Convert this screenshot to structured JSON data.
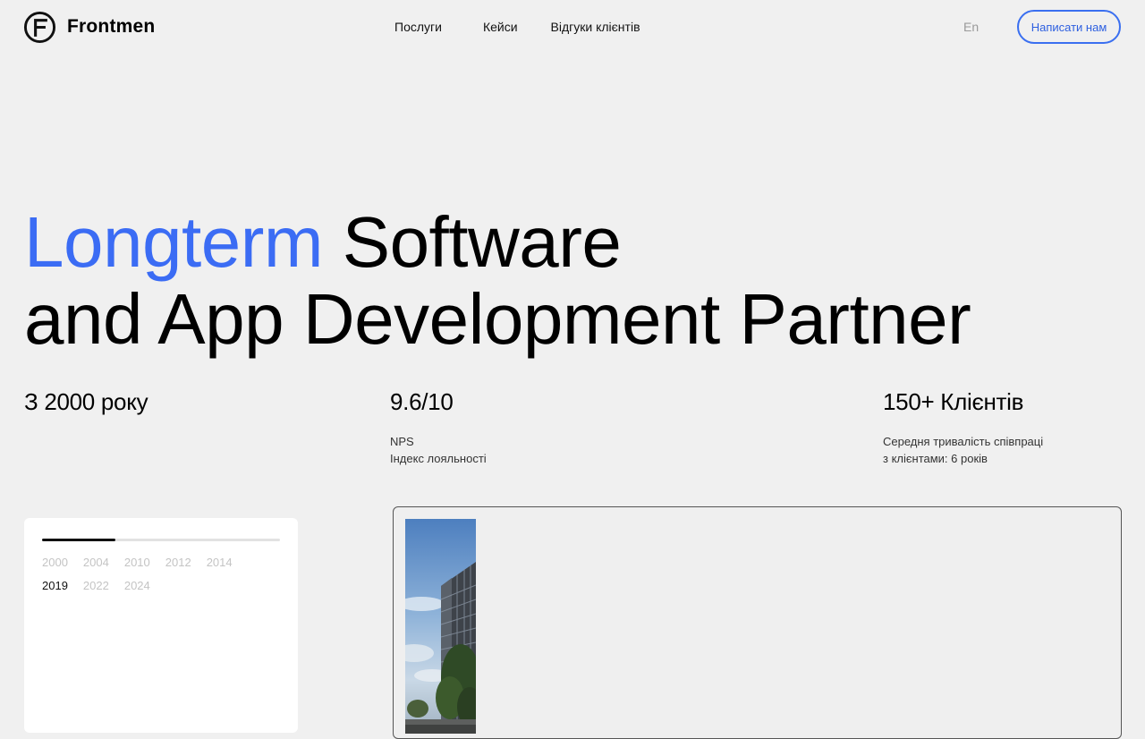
{
  "header": {
    "logo_text": "Frontmen",
    "nav": [
      "Послуги",
      "Кейси",
      "Відгуки клієнтів"
    ],
    "lang": "En",
    "cta_label": "Написати нам"
  },
  "hero": {
    "accent": "Longterm",
    "line1_rest": "Software",
    "line2": "and App Development Partner"
  },
  "stats": [
    {
      "value": "З 2000 року",
      "sub1": "",
      "sub2": ""
    },
    {
      "value": "9.6/10",
      "sub1": "NPS",
      "sub2": "Індекс лояльності"
    },
    {
      "value": "150+ Клієнтів",
      "sub1": "Середня тривалість співпраці",
      "sub2": "з клієнтами: 6 років"
    }
  ],
  "timeline": {
    "years": [
      "2000",
      "2004",
      "2010",
      "2012",
      "2014",
      "2019",
      "2022",
      "2024"
    ],
    "active_year": "2019",
    "progress_fraction": 0.31
  },
  "colors": {
    "accent": "#3b6cf4",
    "background": "#f0f0f0"
  }
}
